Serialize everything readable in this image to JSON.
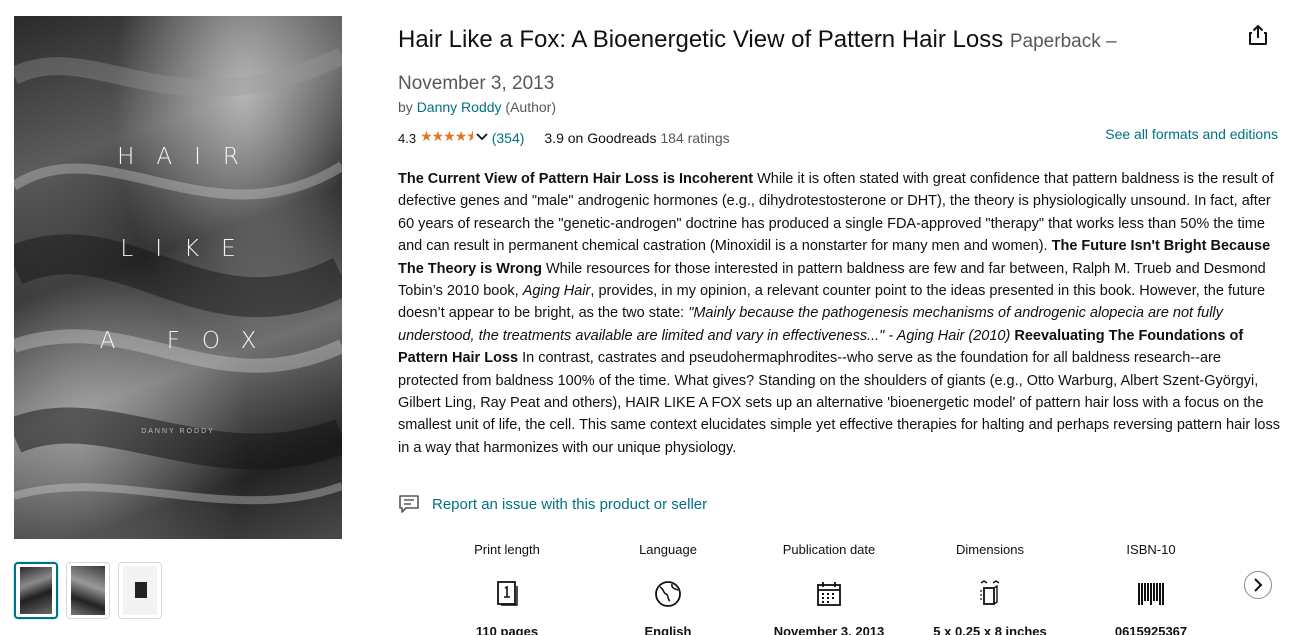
{
  "product": {
    "title": "Hair Like a Fox: A Bioenergetic View of Pattern Hair Loss",
    "format": "Paperback – November 3, 2013",
    "byline_prefix": "by",
    "author": "Danny Roddy",
    "author_role": "(Author)"
  },
  "cover": {
    "words": [
      "HAIR",
      "LIKE",
      "A FOX"
    ],
    "author": "DANNY RODDY"
  },
  "thumbnails": [
    "cover-front",
    "cover-back",
    "cover-flat"
  ],
  "rating": {
    "value": "4.3",
    "stars": "★★★★⯨",
    "count": "(354)",
    "goodreads_score": "3.9 on Goodreads",
    "goodreads_count": "184 ratings"
  },
  "formats_link": "See all formats and editions",
  "description": {
    "h1": "The Current View of Pattern Hair Loss is Incoherent",
    "p1": " While it is often stated with great confidence that pattern baldness is the result of defective genes and \"male\" androgenic hormones (e.g., dihydrotestosterone or DHT), the theory is physiologically unsound. In fact, after 60 years of research the \"genetic-androgen\" doctrine has produced a single FDA-approved \"therapy\" that works less than 50% the time and can result in permanent chemical castration (Minoxidil is a nonstarter for many men and women). ",
    "h2": "The Future Isn't Bright Because The Theory is Wrong",
    "p2a": " While resources for those interested in pattern baldness are few and far between, Ralph M. Trueb and Desmond Tobin’s 2010 book, ",
    "p2_book": "Aging Hair",
    "p2b": ", provides, in my opinion, a relevant counter point to the ideas presented in this book. However, the future doesn’t appear to be bright, as the two state: ",
    "p2_quote": "\"Mainly because the pathogenesis mechanisms of androgenic alopecia are not fully understood, the treatments available are limited and vary in effectiveness...\" - Aging Hair (2010)",
    "h3": " Reevaluating The Foundations of Pattern Hair Loss",
    "p3": " In contrast, castrates and pseudohermaphrodites--who serve as the foundation for all baldness research--are protected from baldness 100% of the time. What gives? Standing on the shoulders of giants (e.g., Otto Warburg, Albert Szent-Györgyi, Gilbert Ling, Ray Peat and others), HAIR LIKE A FOX sets up an alternative 'bioenergetic model' of pattern hair loss with a focus on the smallest unit of life, the cell. This same context elucidates simple yet effective therapies for halting and perhaps reversing pattern hair loss in a way that harmonizes with our unique physiology."
  },
  "report_link": "Report an issue with this product or seller",
  "specs": [
    {
      "label": "Print length",
      "icon": "book-pages-icon",
      "value": "110 pages"
    },
    {
      "label": "Language",
      "icon": "globe-icon",
      "value": "English"
    },
    {
      "label": "Publication date",
      "icon": "calendar-icon",
      "value": "November 3, 2013"
    },
    {
      "label": "Dimensions",
      "icon": "dimensions-icon",
      "value": "5 x 0.25 x 8 inches"
    },
    {
      "label": "ISBN-10",
      "icon": "barcode-icon",
      "value": "0615925367"
    }
  ],
  "colors": {
    "link": "#007185",
    "star": "#de7921",
    "text": "#0f1111",
    "muted": "#565959"
  }
}
